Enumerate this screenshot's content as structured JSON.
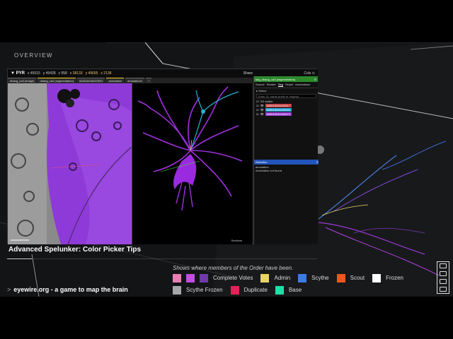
{
  "overlay": {
    "heading": "OVERVIEW",
    "video_title": "Advanced Spelunker: Color Picker Tips",
    "bottom_chevron": ">",
    "bottom_text": "eyewire.org - a game to map the brain",
    "progress_fraction": 0.08
  },
  "app": {
    "logo": "▼ PYR",
    "coords": [
      "x 45515",
      "y 49428",
      "z 958"
    ],
    "cursor_coords": [
      "x 38133",
      "y 49695",
      "z 2138"
    ],
    "share_label": "Share",
    "user_label": "Cols ⊙",
    "layers": [
      "dhang_ca3 (image)",
      "dhang_ca3 (segmentation)",
      "648518346433591",
      "annotation",
      "annotation1",
      "+"
    ],
    "viewer_footer": "Sections"
  },
  "sidepanel": {
    "header": "seg_dhang_ca3 (segmentation)",
    "tabs": [
      "Source",
      "Render",
      "Seg",
      "Graph",
      "Annotations"
    ],
    "select_label": "Select",
    "filter_placeholder": "Enter ID, name prefix or /regexp",
    "visible_label": "3/3 visible",
    "segments": [
      {
        "id": "648518346433517",
        "color": "#c23b3b"
      },
      {
        "id": "648518346433591",
        "color": "#2a9fd6"
      },
      {
        "id": "648518346439872",
        "color": "#9b3ad6"
      }
    ],
    "selection_header": "Selection",
    "selection_lines": [
      "annotation",
      "Annotation not found"
    ]
  },
  "legend": {
    "caption": "Shows where members of the Order have been.",
    "rows": [
      [
        {
          "swatches": [
            "#e77fb5",
            "#c04ee0",
            "#6e3aa8"
          ],
          "label": "Complete Votes"
        },
        {
          "swatches": [
            "#e8d36a"
          ],
          "label": "Admin"
        },
        {
          "swatches": [
            "#3d7ae8"
          ],
          "label": "Scythe"
        },
        {
          "swatches": [
            "#e8581f"
          ],
          "label": "Scout"
        },
        {
          "swatches": [
            "#ffffff"
          ],
          "label": "Frozen"
        }
      ],
      [
        {
          "swatches": [
            "#a7a7a7"
          ],
          "label": "Scythe Frozen"
        },
        {
          "swatches": [
            "#e8205a"
          ],
          "label": "Duplicate"
        },
        {
          "swatches": [
            "#1fe0a8"
          ],
          "label": "Base"
        }
      ]
    ]
  }
}
